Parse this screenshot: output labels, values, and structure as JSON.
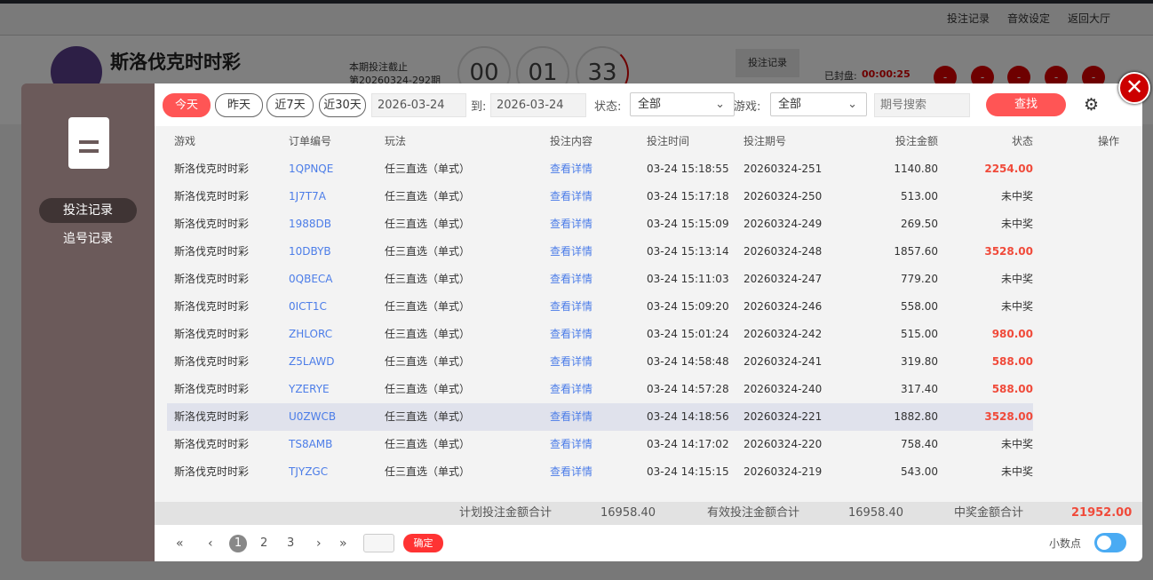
{
  "topbar": {
    "links": [
      "投注记录",
      "音效设定",
      "返回大厅"
    ]
  },
  "game": {
    "name": "斯洛伐克时时彩",
    "cutoff_label": "本期投注截止",
    "period": "第20260324-292期",
    "countdown": [
      "00",
      "01",
      "33"
    ],
    "record_btn": "投注记录",
    "sealed_label": "已封盘:",
    "sealed_time": "00:00:25",
    "balls": [
      "-",
      "-",
      "-",
      "-",
      "-"
    ]
  },
  "sidebar": {
    "icon": "document-icon",
    "items": [
      {
        "label": "投注记录",
        "active": true
      },
      {
        "label": "追号记录",
        "active": false
      }
    ]
  },
  "filters": {
    "quick": [
      "今天",
      "昨天",
      "近7天",
      "近30天"
    ],
    "active_quick": "今天",
    "date_from": "2026-03-24",
    "to_label": "到:",
    "date_to": "2026-03-24",
    "status_label": "状态:",
    "status_value": "全部",
    "game_label": "游戏:",
    "game_value": "全部",
    "period_placeholder": "期号搜索",
    "search_label": "查找"
  },
  "table": {
    "headers": [
      "游戏",
      "订单编号",
      "玩法",
      "投注内容",
      "投注时间",
      "投注期号",
      "投注金额",
      "状态",
      "操作"
    ],
    "rows": [
      [
        "斯洛伐克时时彩",
        "1QPNQE",
        "任三直选（单式）",
        "查看详情",
        "03-24 15:18:55",
        "20260324-251",
        "1140.80",
        "2254.00"
      ],
      [
        "斯洛伐克时时彩",
        "1J7T7A",
        "任三直选（单式）",
        "查看详情",
        "03-24 15:17:18",
        "20260324-250",
        "513.00",
        "未中奖"
      ],
      [
        "斯洛伐克时时彩",
        "1988DB",
        "任三直选（单式）",
        "查看详情",
        "03-24 15:15:09",
        "20260324-249",
        "269.50",
        "未中奖"
      ],
      [
        "斯洛伐克时时彩",
        "10DBYB",
        "任三直选（单式）",
        "查看详情",
        "03-24 15:13:14",
        "20260324-248",
        "1857.60",
        "3528.00"
      ],
      [
        "斯洛伐克时时彩",
        "0QBECA",
        "任三直选（单式）",
        "查看详情",
        "03-24 15:11:03",
        "20260324-247",
        "779.20",
        "未中奖"
      ],
      [
        "斯洛伐克时时彩",
        "0ICT1C",
        "任三直选（单式）",
        "查看详情",
        "03-24 15:09:20",
        "20260324-246",
        "558.00",
        "未中奖"
      ],
      [
        "斯洛伐克时时彩",
        "ZHLORC",
        "任三直选（单式）",
        "查看详情",
        "03-24 15:01:24",
        "20260324-242",
        "515.00",
        "980.00"
      ],
      [
        "斯洛伐克时时彩",
        "Z5LAWD",
        "任三直选（单式）",
        "查看详情",
        "03-24 14:58:48",
        "20260324-241",
        "319.80",
        "588.00"
      ],
      [
        "斯洛伐克时时彩",
        "YZERYE",
        "任三直选（单式）",
        "查看详情",
        "03-24 14:57:28",
        "20260324-240",
        "317.40",
        "588.00"
      ],
      [
        "斯洛伐克时时彩",
        "U0ZWCB",
        "任三直选（单式）",
        "查看详情",
        "03-24 14:18:56",
        "20260324-221",
        "1882.80",
        "3528.00"
      ],
      [
        "斯洛伐克时时彩",
        "TS8AMB",
        "任三直选（单式）",
        "查看详情",
        "03-24 14:17:02",
        "20260324-220",
        "758.40",
        "未中奖"
      ],
      [
        "斯洛伐克时时彩",
        "TJYZGC",
        "任三直选（单式）",
        "查看详情",
        "03-24 14:15:15",
        "20260324-219",
        "543.00",
        "未中奖"
      ]
    ],
    "highlighted_row": 9
  },
  "summary": {
    "planned_label": "计划投注金额合计",
    "planned": "16958.40",
    "valid_label": "有效投注金额合计",
    "valid": "16958.40",
    "win_label": "中奖金额合计",
    "win": "21952.00"
  },
  "pagination": {
    "first": "«",
    "prev": "‹",
    "pages": [
      "1",
      "2",
      "3"
    ],
    "current": "1",
    "next": "›",
    "last": "»",
    "confirm": "确定",
    "decimal_label": "小数点",
    "decimal_on": true
  },
  "colors": {
    "accent": "#ff5555",
    "win": "#f04a3a",
    "link": "#4c7de8"
  }
}
